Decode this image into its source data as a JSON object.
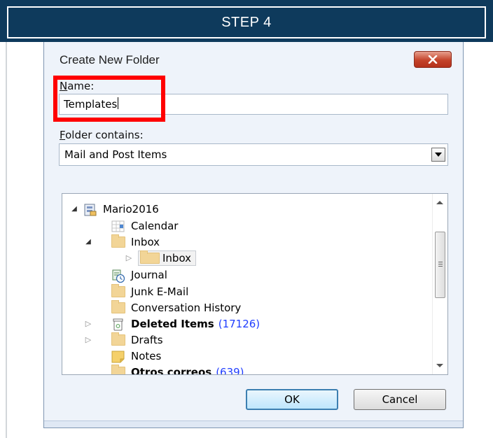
{
  "banner": {
    "title": "STEP 4"
  },
  "dialog": {
    "title": "Create New Folder",
    "name_label_accel": "N",
    "name_label_rest": "ame:",
    "name_value": "Templates",
    "contains_label_accel": "F",
    "contains_label_rest": "older contains:",
    "contains_selected": "Mail and Post Items",
    "ok_label": "OK",
    "cancel_label": "Cancel"
  },
  "tree": {
    "items": [
      {
        "label": "Mario2016",
        "icon": "mailbox-icon"
      },
      {
        "label": "Calendar",
        "icon": "calendar-icon"
      },
      {
        "label": "Inbox",
        "icon": "folder-icon"
      },
      {
        "label": "Inbox",
        "icon": "folder-icon"
      },
      {
        "label": "Journal",
        "icon": "journal-icon"
      },
      {
        "label": "Junk E-Mail",
        "icon": "folder-icon"
      },
      {
        "label": "Conversation History",
        "icon": "folder-icon"
      },
      {
        "label": "Deleted Items",
        "count": "(17126)",
        "icon": "trash-icon"
      },
      {
        "label": "Drafts",
        "icon": "folder-icon"
      },
      {
        "label": "Notes",
        "icon": "notes-icon"
      },
      {
        "label": "Otros correos",
        "count": "(639)",
        "icon": "folder-icon"
      }
    ]
  },
  "colors": {
    "banner_bg": "#0e3a5c",
    "highlight": "#ff0000",
    "count_blue": "#1f3dff"
  }
}
